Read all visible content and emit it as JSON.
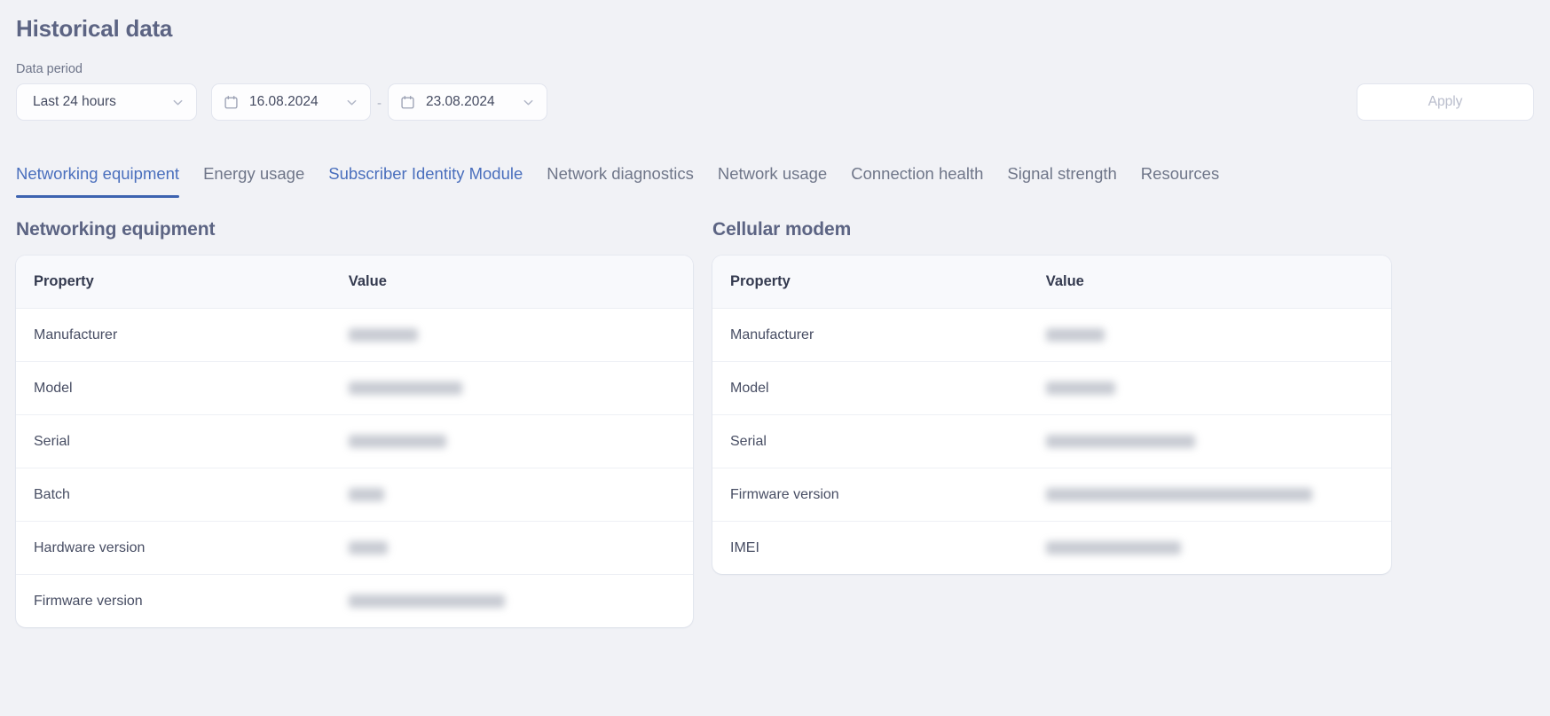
{
  "header": {
    "title": "Historical data"
  },
  "filters": {
    "data_period_label": "Data period",
    "period_select": {
      "value": "Last 24 hours",
      "icon": "chevron-down-icon"
    },
    "date_from": {
      "value": "16.08.2024",
      "icon": "calendar-icon",
      "chevron": "chevron-down-icon"
    },
    "range_separator": "-",
    "date_to": {
      "value": "23.08.2024",
      "icon": "calendar-icon",
      "chevron": "chevron-down-icon"
    },
    "apply_label": "Apply",
    "apply_enabled": false
  },
  "tabs": [
    {
      "label": "Networking equipment",
      "state": "active"
    },
    {
      "label": "Energy usage",
      "state": "muted"
    },
    {
      "label": "Subscriber Identity Module",
      "state": "link"
    },
    {
      "label": "Network diagnostics",
      "state": "muted"
    },
    {
      "label": "Network usage",
      "state": "muted"
    },
    {
      "label": "Connection health",
      "state": "muted"
    },
    {
      "label": "Signal strength",
      "state": "muted"
    },
    {
      "label": "Resources",
      "state": "muted"
    }
  ],
  "panels": [
    {
      "title": "Networking equipment",
      "columns": {
        "property": "Property",
        "value": "Value"
      },
      "rows": [
        {
          "property": "Manufacturer",
          "value": "",
          "redacted": true,
          "redacted_width": 78
        },
        {
          "property": "Model",
          "value": "",
          "redacted": true,
          "redacted_width": 128
        },
        {
          "property": "Serial",
          "value": "",
          "redacted": true,
          "redacted_width": 110
        },
        {
          "property": "Batch",
          "value": "",
          "redacted": true,
          "redacted_width": 40
        },
        {
          "property": "Hardware version",
          "value": "",
          "redacted": true,
          "redacted_width": 44
        },
        {
          "property": "Firmware version",
          "value": "",
          "redacted": true,
          "redacted_width": 176
        }
      ]
    },
    {
      "title": "Cellular modem",
      "columns": {
        "property": "Property",
        "value": "Value"
      },
      "rows": [
        {
          "property": "Manufacturer",
          "value": "",
          "redacted": true,
          "redacted_width": 66
        },
        {
          "property": "Model",
          "value": "",
          "redacted": true,
          "redacted_width": 78
        },
        {
          "property": "Serial",
          "value": "",
          "redacted": true,
          "redacted_width": 168
        },
        {
          "property": "Firmware version",
          "value": "",
          "redacted": true,
          "redacted_width": 300
        },
        {
          "property": "IMEI",
          "value": "",
          "redacted": true,
          "redacted_width": 152
        }
      ]
    }
  ],
  "colors": {
    "page_bg": "#f1f2f6",
    "accent": "#3d63b0",
    "link": "#4a6fbd",
    "title": "#5c6483",
    "muted_text": "#6f7689",
    "card_bg": "#ffffff",
    "disabled_text": "#b8bccb"
  }
}
